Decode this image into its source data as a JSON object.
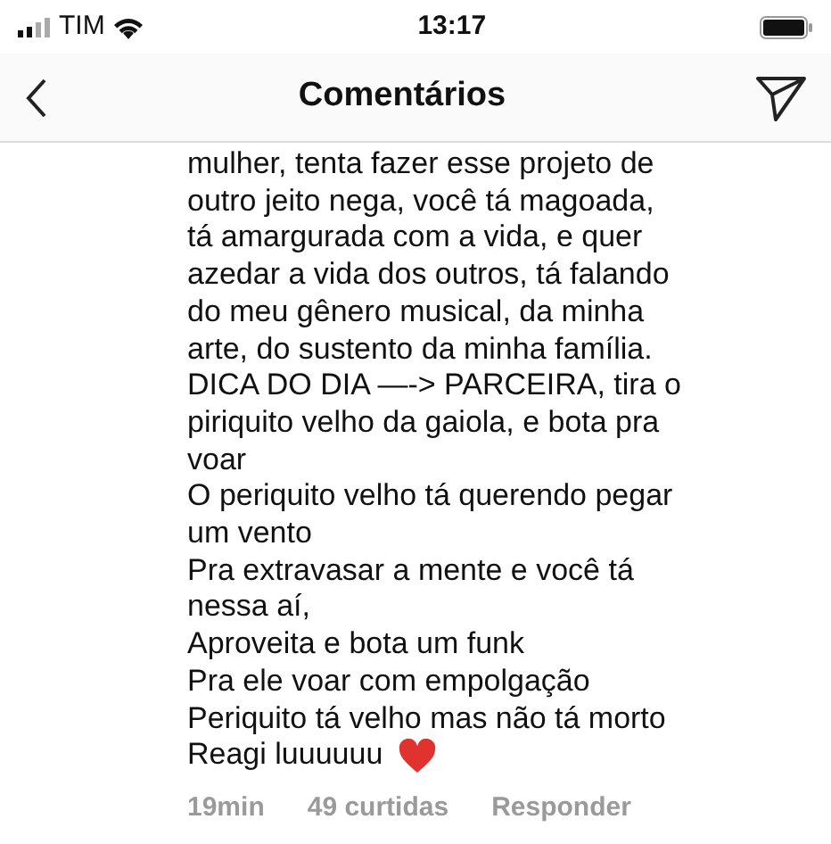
{
  "status_bar": {
    "carrier": "TIM",
    "time": "13:17"
  },
  "header": {
    "title": "Comentários"
  },
  "comment": {
    "lines": [
      "mulher, tenta fazer esse projeto de",
      "outro jeito nega, você tá magoada,",
      "tá amargurada com a vida, e quer",
      "azedar a vida dos outros, tá falando",
      "do meu gênero musical, da minha",
      "arte, do sustento da minha família.",
      "DICA DO DIA —-> PARCEIRA, tira o",
      "piriquito velho da gaiola, e bota pra",
      "voar",
      "O periquito velho tá querendo pegar",
      "um vento",
      "Pra extravasar a mente e você tá",
      "nessa aí,",
      "Aproveita e bota um funk",
      "Pra ele voar com empolgação",
      "Periquito tá velho mas não tá morto",
      "Reagi luuuuuu"
    ],
    "time": "19min",
    "likes": "49 curtidas",
    "reply": "Responder"
  }
}
